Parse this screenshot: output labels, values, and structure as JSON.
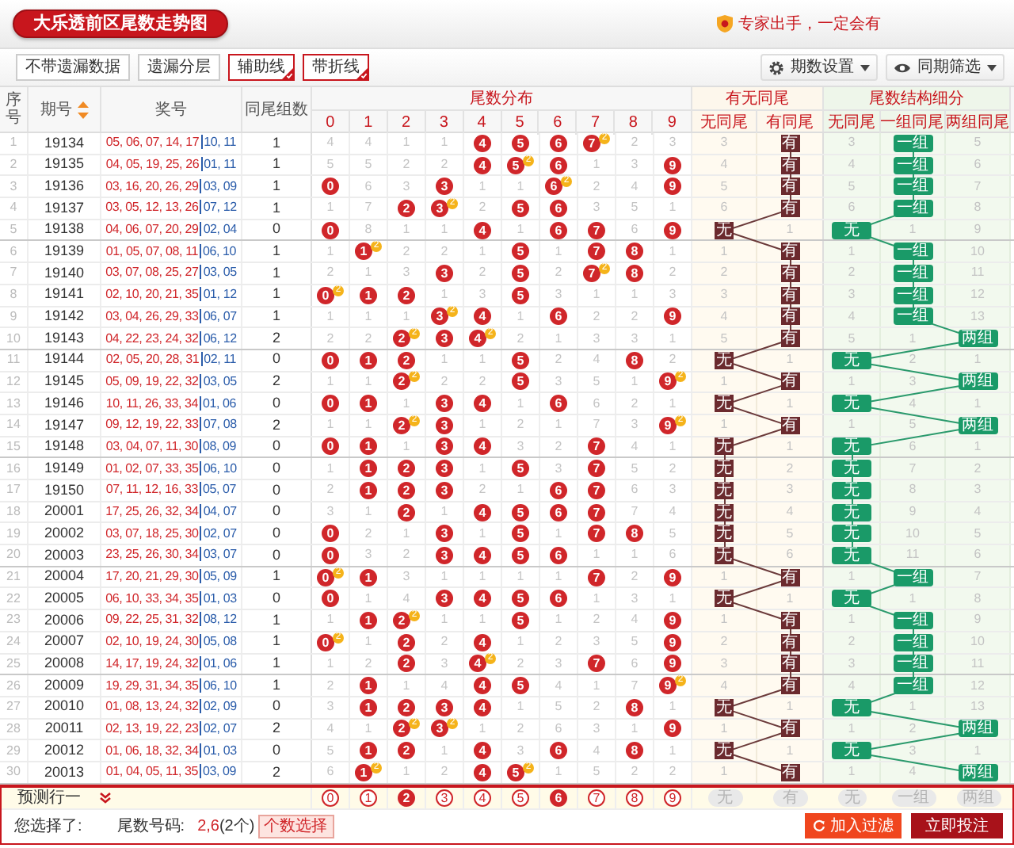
{
  "title": "大乐透前区尾数走势图",
  "promo": "专家出手，一定会有",
  "toolbar": {
    "toggles": [
      {
        "label": "不带遗漏数据",
        "selected": false
      },
      {
        "label": "遗漏分层",
        "selected": false
      },
      {
        "label": "辅助线",
        "selected": true
      },
      {
        "label": "带折线",
        "selected": true
      }
    ],
    "dropdowns": [
      {
        "kind": "settings",
        "label": "期数设置"
      },
      {
        "kind": "view",
        "label": "同期筛选"
      }
    ]
  },
  "columns": {
    "seq": "序号",
    "issue": "期号",
    "numbers": "奖号",
    "count": "同尾组数",
    "tail_group": "尾数分布",
    "tail_digits": [
      "0",
      "1",
      "2",
      "3",
      "4",
      "5",
      "6",
      "7",
      "8",
      "9"
    ],
    "same_group": "有无同尾",
    "same_cols": [
      "无同尾",
      "有同尾"
    ],
    "structure_group": "尾数结构细分",
    "structure_cols": [
      "无同尾",
      "一组同尾",
      "两组同尾"
    ]
  },
  "rows": [
    {
      "seq": "1",
      "issue": "19134",
      "front": "05, 06, 07, 14, 17",
      "back": "10, 11",
      "count": "1",
      "tails": [
        {
          "text": "4",
          "hit": false
        },
        {
          "text": "4",
          "hit": false
        },
        {
          "text": "1",
          "hit": false
        },
        {
          "text": "1",
          "hit": false
        },
        {
          "text": "4",
          "hit": true
        },
        {
          "text": "5",
          "hit": true
        },
        {
          "text": "6",
          "hit": true
        },
        {
          "text": "7",
          "hit": true,
          "badge": "2"
        },
        {
          "text": "2",
          "hit": false
        },
        {
          "text": "3",
          "hit": false
        }
      ],
      "same_tail": [
        {
          "text": "3",
          "hit": false
        },
        {
          "text": "有",
          "hit": true
        }
      ],
      "structure": [
        {
          "text": "3",
          "hit": false
        },
        {
          "text": "一组",
          "hit": true
        },
        {
          "text": "5",
          "hit": false
        }
      ]
    },
    {
      "seq": "2",
      "issue": "19135",
      "front": "04, 05, 19, 25, 26",
      "back": "01, 11",
      "count": "1",
      "tails": [
        {
          "text": "5",
          "hit": false
        },
        {
          "text": "5",
          "hit": false
        },
        {
          "text": "2",
          "hit": false
        },
        {
          "text": "2",
          "hit": false
        },
        {
          "text": "4",
          "hit": true
        },
        {
          "text": "5",
          "hit": true,
          "badge": "2"
        },
        {
          "text": "6",
          "hit": true
        },
        {
          "text": "1",
          "hit": false
        },
        {
          "text": "3",
          "hit": false
        },
        {
          "text": "9",
          "hit": true
        }
      ],
      "same_tail": [
        {
          "text": "4",
          "hit": false
        },
        {
          "text": "有",
          "hit": true
        }
      ],
      "structure": [
        {
          "text": "4",
          "hit": false
        },
        {
          "text": "一组",
          "hit": true
        },
        {
          "text": "6",
          "hit": false
        }
      ]
    },
    {
      "seq": "3",
      "issue": "19136",
      "front": "03, 16, 20, 26, 29",
      "back": "03, 09",
      "count": "1",
      "tails": [
        {
          "text": "0",
          "hit": true
        },
        {
          "text": "6",
          "hit": false
        },
        {
          "text": "3",
          "hit": false
        },
        {
          "text": "3",
          "hit": true
        },
        {
          "text": "1",
          "hit": false
        },
        {
          "text": "1",
          "hit": false
        },
        {
          "text": "6",
          "hit": true,
          "badge": "2"
        },
        {
          "text": "2",
          "hit": false
        },
        {
          "text": "4",
          "hit": false
        },
        {
          "text": "9",
          "hit": true
        }
      ],
      "same_tail": [
        {
          "text": "5",
          "hit": false
        },
        {
          "text": "有",
          "hit": true
        }
      ],
      "structure": [
        {
          "text": "5",
          "hit": false
        },
        {
          "text": "一组",
          "hit": true
        },
        {
          "text": "7",
          "hit": false
        }
      ]
    },
    {
      "seq": "4",
      "issue": "19137",
      "front": "03, 05, 12, 13, 26",
      "back": "07, 12",
      "count": "1",
      "tails": [
        {
          "text": "1",
          "hit": false
        },
        {
          "text": "7",
          "hit": false
        },
        {
          "text": "2",
          "hit": true
        },
        {
          "text": "3",
          "hit": true,
          "badge": "2"
        },
        {
          "text": "2",
          "hit": false
        },
        {
          "text": "5",
          "hit": true
        },
        {
          "text": "6",
          "hit": true
        },
        {
          "text": "3",
          "hit": false
        },
        {
          "text": "5",
          "hit": false
        },
        {
          "text": "1",
          "hit": false
        }
      ],
      "same_tail": [
        {
          "text": "6",
          "hit": false
        },
        {
          "text": "有",
          "hit": true
        }
      ],
      "structure": [
        {
          "text": "6",
          "hit": false
        },
        {
          "text": "一组",
          "hit": true
        },
        {
          "text": "8",
          "hit": false
        }
      ]
    },
    {
      "seq": "5",
      "issue": "19138",
      "front": "04, 06, 07, 20, 29",
      "back": "02, 04",
      "count": "0",
      "tails": [
        {
          "text": "0",
          "hit": true
        },
        {
          "text": "8",
          "hit": false
        },
        {
          "text": "1",
          "hit": false
        },
        {
          "text": "1",
          "hit": false
        },
        {
          "text": "4",
          "hit": true
        },
        {
          "text": "1",
          "hit": false
        },
        {
          "text": "6",
          "hit": true
        },
        {
          "text": "7",
          "hit": true
        },
        {
          "text": "6",
          "hit": false
        },
        {
          "text": "9",
          "hit": true
        }
      ],
      "same_tail": [
        {
          "text": "无",
          "hit": true
        },
        {
          "text": "1",
          "hit": false
        }
      ],
      "structure": [
        {
          "text": "无",
          "hit": true
        },
        {
          "text": "1",
          "hit": false
        },
        {
          "text": "9",
          "hit": false
        }
      ]
    },
    {
      "seq": "6",
      "issue": "19139",
      "front": "01, 05, 07, 08, 11",
      "back": "06, 10",
      "count": "1",
      "tails": [
        {
          "text": "1",
          "hit": false
        },
        {
          "text": "1",
          "hit": true,
          "badge": "2"
        },
        {
          "text": "2",
          "hit": false
        },
        {
          "text": "2",
          "hit": false
        },
        {
          "text": "1",
          "hit": false
        },
        {
          "text": "5",
          "hit": true
        },
        {
          "text": "1",
          "hit": false
        },
        {
          "text": "7",
          "hit": true
        },
        {
          "text": "8",
          "hit": true
        },
        {
          "text": "1",
          "hit": false
        }
      ],
      "same_tail": [
        {
          "text": "1",
          "hit": false
        },
        {
          "text": "有",
          "hit": true
        }
      ],
      "structure": [
        {
          "text": "1",
          "hit": false
        },
        {
          "text": "一组",
          "hit": true
        },
        {
          "text": "10",
          "hit": false
        }
      ]
    },
    {
      "seq": "7",
      "issue": "19140",
      "front": "03, 07, 08, 25, 27",
      "back": "03, 05",
      "count": "1",
      "tails": [
        {
          "text": "2",
          "hit": false
        },
        {
          "text": "1",
          "hit": false
        },
        {
          "text": "3",
          "hit": false
        },
        {
          "text": "3",
          "hit": true
        },
        {
          "text": "2",
          "hit": false
        },
        {
          "text": "5",
          "hit": true
        },
        {
          "text": "2",
          "hit": false
        },
        {
          "text": "7",
          "hit": true,
          "badge": "2"
        },
        {
          "text": "8",
          "hit": true
        },
        {
          "text": "2",
          "hit": false
        }
      ],
      "same_tail": [
        {
          "text": "2",
          "hit": false
        },
        {
          "text": "有",
          "hit": true
        }
      ],
      "structure": [
        {
          "text": "2",
          "hit": false
        },
        {
          "text": "一组",
          "hit": true
        },
        {
          "text": "11",
          "hit": false
        }
      ]
    },
    {
      "seq": "8",
      "issue": "19141",
      "front": "02, 10, 20, 21, 35",
      "back": "01, 12",
      "count": "1",
      "tails": [
        {
          "text": "0",
          "hit": true,
          "badge": "2"
        },
        {
          "text": "1",
          "hit": true
        },
        {
          "text": "2",
          "hit": true
        },
        {
          "text": "1",
          "hit": false
        },
        {
          "text": "3",
          "hit": false
        },
        {
          "text": "5",
          "hit": true
        },
        {
          "text": "3",
          "hit": false
        },
        {
          "text": "1",
          "hit": false
        },
        {
          "text": "1",
          "hit": false
        },
        {
          "text": "3",
          "hit": false
        }
      ],
      "same_tail": [
        {
          "text": "3",
          "hit": false
        },
        {
          "text": "有",
          "hit": true
        }
      ],
      "structure": [
        {
          "text": "3",
          "hit": false
        },
        {
          "text": "一组",
          "hit": true
        },
        {
          "text": "12",
          "hit": false
        }
      ]
    },
    {
      "seq": "9",
      "issue": "19142",
      "front": "03, 04, 26, 29, 33",
      "back": "06, 07",
      "count": "1",
      "tails": [
        {
          "text": "1",
          "hit": false
        },
        {
          "text": "1",
          "hit": false
        },
        {
          "text": "1",
          "hit": false
        },
        {
          "text": "3",
          "hit": true,
          "badge": "2"
        },
        {
          "text": "4",
          "hit": true
        },
        {
          "text": "1",
          "hit": false
        },
        {
          "text": "6",
          "hit": true
        },
        {
          "text": "2",
          "hit": false
        },
        {
          "text": "2",
          "hit": false
        },
        {
          "text": "9",
          "hit": true
        }
      ],
      "same_tail": [
        {
          "text": "4",
          "hit": false
        },
        {
          "text": "有",
          "hit": true
        }
      ],
      "structure": [
        {
          "text": "4",
          "hit": false
        },
        {
          "text": "一组",
          "hit": true
        },
        {
          "text": "13",
          "hit": false
        }
      ]
    },
    {
      "seq": "10",
      "issue": "19143",
      "front": "04, 22, 23, 24, 32",
      "back": "06, 12",
      "count": "2",
      "tails": [
        {
          "text": "2",
          "hit": false
        },
        {
          "text": "2",
          "hit": false
        },
        {
          "text": "2",
          "hit": true,
          "badge": "2"
        },
        {
          "text": "3",
          "hit": true
        },
        {
          "text": "4",
          "hit": true,
          "badge": "2"
        },
        {
          "text": "2",
          "hit": false
        },
        {
          "text": "1",
          "hit": false
        },
        {
          "text": "3",
          "hit": false
        },
        {
          "text": "3",
          "hit": false
        },
        {
          "text": "1",
          "hit": false
        }
      ],
      "same_tail": [
        {
          "text": "5",
          "hit": false
        },
        {
          "text": "有",
          "hit": true
        }
      ],
      "structure": [
        {
          "text": "5",
          "hit": false
        },
        {
          "text": "1",
          "hit": false
        },
        {
          "text": "两组",
          "hit": true
        }
      ]
    },
    {
      "seq": "11",
      "issue": "19144",
      "front": "02, 05, 20, 28, 31",
      "back": "02, 11",
      "count": "0",
      "tails": [
        {
          "text": "0",
          "hit": true
        },
        {
          "text": "1",
          "hit": true
        },
        {
          "text": "2",
          "hit": true
        },
        {
          "text": "1",
          "hit": false
        },
        {
          "text": "1",
          "hit": false
        },
        {
          "text": "5",
          "hit": true
        },
        {
          "text": "2",
          "hit": false
        },
        {
          "text": "4",
          "hit": false
        },
        {
          "text": "8",
          "hit": true
        },
        {
          "text": "2",
          "hit": false
        }
      ],
      "same_tail": [
        {
          "text": "无",
          "hit": true
        },
        {
          "text": "1",
          "hit": false
        }
      ],
      "structure": [
        {
          "text": "无",
          "hit": true
        },
        {
          "text": "2",
          "hit": false
        },
        {
          "text": "1",
          "hit": false
        }
      ]
    },
    {
      "seq": "12",
      "issue": "19145",
      "front": "05, 09, 19, 22, 32",
      "back": "03, 05",
      "count": "2",
      "tails": [
        {
          "text": "1",
          "hit": false
        },
        {
          "text": "1",
          "hit": false
        },
        {
          "text": "2",
          "hit": true,
          "badge": "2"
        },
        {
          "text": "2",
          "hit": false
        },
        {
          "text": "2",
          "hit": false
        },
        {
          "text": "5",
          "hit": true
        },
        {
          "text": "3",
          "hit": false
        },
        {
          "text": "5",
          "hit": false
        },
        {
          "text": "1",
          "hit": false
        },
        {
          "text": "9",
          "hit": true,
          "badge": "2"
        }
      ],
      "same_tail": [
        {
          "text": "1",
          "hit": false
        },
        {
          "text": "有",
          "hit": true
        }
      ],
      "structure": [
        {
          "text": "1",
          "hit": false
        },
        {
          "text": "3",
          "hit": false
        },
        {
          "text": "两组",
          "hit": true
        }
      ]
    },
    {
      "seq": "13",
      "issue": "19146",
      "front": "10, 11, 26, 33, 34",
      "back": "01, 06",
      "count": "0",
      "tails": [
        {
          "text": "0",
          "hit": true
        },
        {
          "text": "1",
          "hit": true
        },
        {
          "text": "1",
          "hit": false
        },
        {
          "text": "3",
          "hit": true
        },
        {
          "text": "4",
          "hit": true
        },
        {
          "text": "1",
          "hit": false
        },
        {
          "text": "6",
          "hit": true
        },
        {
          "text": "6",
          "hit": false
        },
        {
          "text": "2",
          "hit": false
        },
        {
          "text": "1",
          "hit": false
        }
      ],
      "same_tail": [
        {
          "text": "无",
          "hit": true
        },
        {
          "text": "1",
          "hit": false
        }
      ],
      "structure": [
        {
          "text": "无",
          "hit": true
        },
        {
          "text": "4",
          "hit": false
        },
        {
          "text": "1",
          "hit": false
        }
      ]
    },
    {
      "seq": "14",
      "issue": "19147",
      "front": "09, 12, 19, 22, 33",
      "back": "07, 08",
      "count": "2",
      "tails": [
        {
          "text": "1",
          "hit": false
        },
        {
          "text": "1",
          "hit": false
        },
        {
          "text": "2",
          "hit": true,
          "badge": "2"
        },
        {
          "text": "3",
          "hit": true
        },
        {
          "text": "1",
          "hit": false
        },
        {
          "text": "2",
          "hit": false
        },
        {
          "text": "1",
          "hit": false
        },
        {
          "text": "7",
          "hit": false
        },
        {
          "text": "3",
          "hit": false
        },
        {
          "text": "9",
          "hit": true,
          "badge": "2"
        }
      ],
      "same_tail": [
        {
          "text": "1",
          "hit": false
        },
        {
          "text": "有",
          "hit": true
        }
      ],
      "structure": [
        {
          "text": "1",
          "hit": false
        },
        {
          "text": "5",
          "hit": false
        },
        {
          "text": "两组",
          "hit": true
        }
      ]
    },
    {
      "seq": "15",
      "issue": "19148",
      "front": "03, 04, 07, 11, 30",
      "back": "08, 09",
      "count": "0",
      "tails": [
        {
          "text": "0",
          "hit": true
        },
        {
          "text": "1",
          "hit": true
        },
        {
          "text": "1",
          "hit": false
        },
        {
          "text": "3",
          "hit": true
        },
        {
          "text": "4",
          "hit": true
        },
        {
          "text": "3",
          "hit": false
        },
        {
          "text": "2",
          "hit": false
        },
        {
          "text": "7",
          "hit": true
        },
        {
          "text": "4",
          "hit": false
        },
        {
          "text": "1",
          "hit": false
        }
      ],
      "same_tail": [
        {
          "text": "无",
          "hit": true
        },
        {
          "text": "1",
          "hit": false
        }
      ],
      "structure": [
        {
          "text": "无",
          "hit": true
        },
        {
          "text": "6",
          "hit": false
        },
        {
          "text": "1",
          "hit": false
        }
      ]
    },
    {
      "seq": "16",
      "issue": "19149",
      "front": "01, 02, 07, 33, 35",
      "back": "06, 10",
      "count": "0",
      "tails": [
        {
          "text": "1",
          "hit": false
        },
        {
          "text": "1",
          "hit": true
        },
        {
          "text": "2",
          "hit": true
        },
        {
          "text": "3",
          "hit": true
        },
        {
          "text": "1",
          "hit": false
        },
        {
          "text": "5",
          "hit": true
        },
        {
          "text": "3",
          "hit": false
        },
        {
          "text": "7",
          "hit": true
        },
        {
          "text": "5",
          "hit": false
        },
        {
          "text": "2",
          "hit": false
        }
      ],
      "same_tail": [
        {
          "text": "无",
          "hit": true
        },
        {
          "text": "2",
          "hit": false
        }
      ],
      "structure": [
        {
          "text": "无",
          "hit": true
        },
        {
          "text": "7",
          "hit": false
        },
        {
          "text": "2",
          "hit": false
        }
      ]
    },
    {
      "seq": "17",
      "issue": "19150",
      "front": "07, 11, 12, 16, 33",
      "back": "05, 07",
      "count": "0",
      "tails": [
        {
          "text": "2",
          "hit": false
        },
        {
          "text": "1",
          "hit": true
        },
        {
          "text": "2",
          "hit": true
        },
        {
          "text": "3",
          "hit": true
        },
        {
          "text": "2",
          "hit": false
        },
        {
          "text": "1",
          "hit": false
        },
        {
          "text": "6",
          "hit": true
        },
        {
          "text": "7",
          "hit": true
        },
        {
          "text": "6",
          "hit": false
        },
        {
          "text": "3",
          "hit": false
        }
      ],
      "same_tail": [
        {
          "text": "无",
          "hit": true
        },
        {
          "text": "3",
          "hit": false
        }
      ],
      "structure": [
        {
          "text": "无",
          "hit": true
        },
        {
          "text": "8",
          "hit": false
        },
        {
          "text": "3",
          "hit": false
        }
      ]
    },
    {
      "seq": "18",
      "issue": "20001",
      "front": "17, 25, 26, 32, 34",
      "back": "04, 07",
      "count": "0",
      "tails": [
        {
          "text": "3",
          "hit": false
        },
        {
          "text": "1",
          "hit": false
        },
        {
          "text": "2",
          "hit": true
        },
        {
          "text": "1",
          "hit": false
        },
        {
          "text": "4",
          "hit": true
        },
        {
          "text": "5",
          "hit": true
        },
        {
          "text": "6",
          "hit": true
        },
        {
          "text": "7",
          "hit": true
        },
        {
          "text": "7",
          "hit": false
        },
        {
          "text": "4",
          "hit": false
        }
      ],
      "same_tail": [
        {
          "text": "无",
          "hit": true
        },
        {
          "text": "4",
          "hit": false
        }
      ],
      "structure": [
        {
          "text": "无",
          "hit": true
        },
        {
          "text": "9",
          "hit": false
        },
        {
          "text": "4",
          "hit": false
        }
      ]
    },
    {
      "seq": "19",
      "issue": "20002",
      "front": "03, 07, 18, 25, 30",
      "back": "02, 07",
      "count": "0",
      "tails": [
        {
          "text": "0",
          "hit": true
        },
        {
          "text": "2",
          "hit": false
        },
        {
          "text": "1",
          "hit": false
        },
        {
          "text": "3",
          "hit": true
        },
        {
          "text": "1",
          "hit": false
        },
        {
          "text": "5",
          "hit": true
        },
        {
          "text": "1",
          "hit": false
        },
        {
          "text": "7",
          "hit": true
        },
        {
          "text": "8",
          "hit": true
        },
        {
          "text": "5",
          "hit": false
        }
      ],
      "same_tail": [
        {
          "text": "无",
          "hit": true
        },
        {
          "text": "5",
          "hit": false
        }
      ],
      "structure": [
        {
          "text": "无",
          "hit": true
        },
        {
          "text": "10",
          "hit": false
        },
        {
          "text": "5",
          "hit": false
        }
      ]
    },
    {
      "seq": "20",
      "issue": "20003",
      "front": "23, 25, 26, 30, 34",
      "back": "03, 07",
      "count": "0",
      "tails": [
        {
          "text": "0",
          "hit": true
        },
        {
          "text": "3",
          "hit": false
        },
        {
          "text": "2",
          "hit": false
        },
        {
          "text": "3",
          "hit": true
        },
        {
          "text": "4",
          "hit": true
        },
        {
          "text": "5",
          "hit": true
        },
        {
          "text": "6",
          "hit": true
        },
        {
          "text": "1",
          "hit": false
        },
        {
          "text": "1",
          "hit": false
        },
        {
          "text": "6",
          "hit": false
        }
      ],
      "same_tail": [
        {
          "text": "无",
          "hit": true
        },
        {
          "text": "6",
          "hit": false
        }
      ],
      "structure": [
        {
          "text": "无",
          "hit": true
        },
        {
          "text": "11",
          "hit": false
        },
        {
          "text": "6",
          "hit": false
        }
      ]
    },
    {
      "seq": "21",
      "issue": "20004",
      "front": "17, 20, 21, 29, 30",
      "back": "05, 09",
      "count": "1",
      "tails": [
        {
          "text": "0",
          "hit": true,
          "badge": "2"
        },
        {
          "text": "1",
          "hit": true
        },
        {
          "text": "3",
          "hit": false
        },
        {
          "text": "1",
          "hit": false
        },
        {
          "text": "1",
          "hit": false
        },
        {
          "text": "1",
          "hit": false
        },
        {
          "text": "1",
          "hit": false
        },
        {
          "text": "7",
          "hit": true
        },
        {
          "text": "2",
          "hit": false
        },
        {
          "text": "9",
          "hit": true
        }
      ],
      "same_tail": [
        {
          "text": "1",
          "hit": false
        },
        {
          "text": "有",
          "hit": true
        }
      ],
      "structure": [
        {
          "text": "1",
          "hit": false
        },
        {
          "text": "一组",
          "hit": true
        },
        {
          "text": "7",
          "hit": false
        }
      ]
    },
    {
      "seq": "22",
      "issue": "20005",
      "front": "06, 10, 33, 34, 35",
      "back": "01, 03",
      "count": "0",
      "tails": [
        {
          "text": "0",
          "hit": true
        },
        {
          "text": "1",
          "hit": false
        },
        {
          "text": "4",
          "hit": false
        },
        {
          "text": "3",
          "hit": true
        },
        {
          "text": "4",
          "hit": true
        },
        {
          "text": "5",
          "hit": true
        },
        {
          "text": "6",
          "hit": true
        },
        {
          "text": "1",
          "hit": false
        },
        {
          "text": "3",
          "hit": false
        },
        {
          "text": "1",
          "hit": false
        }
      ],
      "same_tail": [
        {
          "text": "无",
          "hit": true
        },
        {
          "text": "1",
          "hit": false
        }
      ],
      "structure": [
        {
          "text": "无",
          "hit": true
        },
        {
          "text": "1",
          "hit": false
        },
        {
          "text": "8",
          "hit": false
        }
      ]
    },
    {
      "seq": "23",
      "issue": "20006",
      "front": "09, 22, 25, 31, 32",
      "back": "08, 12",
      "count": "1",
      "tails": [
        {
          "text": "1",
          "hit": false
        },
        {
          "text": "1",
          "hit": true
        },
        {
          "text": "2",
          "hit": true,
          "badge": "2"
        },
        {
          "text": "1",
          "hit": false
        },
        {
          "text": "1",
          "hit": false
        },
        {
          "text": "5",
          "hit": true
        },
        {
          "text": "1",
          "hit": false
        },
        {
          "text": "2",
          "hit": false
        },
        {
          "text": "4",
          "hit": false
        },
        {
          "text": "9",
          "hit": true
        }
      ],
      "same_tail": [
        {
          "text": "1",
          "hit": false
        },
        {
          "text": "有",
          "hit": true
        }
      ],
      "structure": [
        {
          "text": "1",
          "hit": false
        },
        {
          "text": "一组",
          "hit": true
        },
        {
          "text": "9",
          "hit": false
        }
      ]
    },
    {
      "seq": "24",
      "issue": "20007",
      "front": "02, 10, 19, 24, 30",
      "back": "05, 08",
      "count": "1",
      "tails": [
        {
          "text": "0",
          "hit": true,
          "badge": "2"
        },
        {
          "text": "1",
          "hit": false
        },
        {
          "text": "2",
          "hit": true
        },
        {
          "text": "2",
          "hit": false
        },
        {
          "text": "4",
          "hit": true
        },
        {
          "text": "1",
          "hit": false
        },
        {
          "text": "2",
          "hit": false
        },
        {
          "text": "3",
          "hit": false
        },
        {
          "text": "5",
          "hit": false
        },
        {
          "text": "9",
          "hit": true
        }
      ],
      "same_tail": [
        {
          "text": "2",
          "hit": false
        },
        {
          "text": "有",
          "hit": true
        }
      ],
      "structure": [
        {
          "text": "2",
          "hit": false
        },
        {
          "text": "一组",
          "hit": true
        },
        {
          "text": "10",
          "hit": false
        }
      ]
    },
    {
      "seq": "25",
      "issue": "20008",
      "front": "14, 17, 19, 24, 32",
      "back": "01, 06",
      "count": "1",
      "tails": [
        {
          "text": "1",
          "hit": false
        },
        {
          "text": "2",
          "hit": false
        },
        {
          "text": "2",
          "hit": true
        },
        {
          "text": "3",
          "hit": false
        },
        {
          "text": "4",
          "hit": true,
          "badge": "2"
        },
        {
          "text": "2",
          "hit": false
        },
        {
          "text": "3",
          "hit": false
        },
        {
          "text": "7",
          "hit": true
        },
        {
          "text": "6",
          "hit": false
        },
        {
          "text": "9",
          "hit": true
        }
      ],
      "same_tail": [
        {
          "text": "3",
          "hit": false
        },
        {
          "text": "有",
          "hit": true
        }
      ],
      "structure": [
        {
          "text": "3",
          "hit": false
        },
        {
          "text": "一组",
          "hit": true
        },
        {
          "text": "11",
          "hit": false
        }
      ]
    },
    {
      "seq": "26",
      "issue": "20009",
      "front": "19, 29, 31, 34, 35",
      "back": "06, 10",
      "count": "1",
      "tails": [
        {
          "text": "2",
          "hit": false
        },
        {
          "text": "1",
          "hit": true
        },
        {
          "text": "1",
          "hit": false
        },
        {
          "text": "4",
          "hit": false
        },
        {
          "text": "4",
          "hit": true
        },
        {
          "text": "5",
          "hit": true
        },
        {
          "text": "4",
          "hit": false
        },
        {
          "text": "1",
          "hit": false
        },
        {
          "text": "7",
          "hit": false
        },
        {
          "text": "9",
          "hit": true,
          "badge": "2"
        }
      ],
      "same_tail": [
        {
          "text": "4",
          "hit": false
        },
        {
          "text": "有",
          "hit": true
        }
      ],
      "structure": [
        {
          "text": "4",
          "hit": false
        },
        {
          "text": "一组",
          "hit": true
        },
        {
          "text": "12",
          "hit": false
        }
      ]
    },
    {
      "seq": "27",
      "issue": "20010",
      "front": "01, 08, 13, 24, 32",
      "back": "02, 09",
      "count": "0",
      "tails": [
        {
          "text": "3",
          "hit": false
        },
        {
          "text": "1",
          "hit": true
        },
        {
          "text": "2",
          "hit": true
        },
        {
          "text": "3",
          "hit": true
        },
        {
          "text": "4",
          "hit": true
        },
        {
          "text": "1",
          "hit": false
        },
        {
          "text": "5",
          "hit": false
        },
        {
          "text": "2",
          "hit": false
        },
        {
          "text": "8",
          "hit": true
        },
        {
          "text": "1",
          "hit": false
        }
      ],
      "same_tail": [
        {
          "text": "无",
          "hit": true
        },
        {
          "text": "1",
          "hit": false
        }
      ],
      "structure": [
        {
          "text": "无",
          "hit": true
        },
        {
          "text": "1",
          "hit": false
        },
        {
          "text": "13",
          "hit": false
        }
      ]
    },
    {
      "seq": "28",
      "issue": "20011",
      "front": "02, 13, 19, 22, 23",
      "back": "02, 07",
      "count": "2",
      "tails": [
        {
          "text": "4",
          "hit": false
        },
        {
          "text": "1",
          "hit": false
        },
        {
          "text": "2",
          "hit": true,
          "badge": "2"
        },
        {
          "text": "3",
          "hit": true,
          "badge": "2"
        },
        {
          "text": "1",
          "hit": false
        },
        {
          "text": "2",
          "hit": false
        },
        {
          "text": "6",
          "hit": false
        },
        {
          "text": "3",
          "hit": false
        },
        {
          "text": "1",
          "hit": false
        },
        {
          "text": "9",
          "hit": true
        }
      ],
      "same_tail": [
        {
          "text": "1",
          "hit": false
        },
        {
          "text": "有",
          "hit": true
        }
      ],
      "structure": [
        {
          "text": "1",
          "hit": false
        },
        {
          "text": "2",
          "hit": false
        },
        {
          "text": "两组",
          "hit": true
        }
      ]
    },
    {
      "seq": "29",
      "issue": "20012",
      "front": "01, 06, 18, 32, 34",
      "back": "01, 03",
      "count": "0",
      "tails": [
        {
          "text": "5",
          "hit": false
        },
        {
          "text": "1",
          "hit": true
        },
        {
          "text": "2",
          "hit": true
        },
        {
          "text": "1",
          "hit": false
        },
        {
          "text": "4",
          "hit": true
        },
        {
          "text": "3",
          "hit": false
        },
        {
          "text": "6",
          "hit": true
        },
        {
          "text": "4",
          "hit": false
        },
        {
          "text": "8",
          "hit": true
        },
        {
          "text": "1",
          "hit": false
        }
      ],
      "same_tail": [
        {
          "text": "无",
          "hit": true
        },
        {
          "text": "1",
          "hit": false
        }
      ],
      "structure": [
        {
          "text": "无",
          "hit": true
        },
        {
          "text": "3",
          "hit": false
        },
        {
          "text": "1",
          "hit": false
        }
      ]
    },
    {
      "seq": "30",
      "issue": "20013",
      "front": "01, 04, 05, 11, 35",
      "back": "03, 09",
      "count": "2",
      "tails": [
        {
          "text": "6",
          "hit": false
        },
        {
          "text": "1",
          "hit": true,
          "badge": "2"
        },
        {
          "text": "1",
          "hit": false
        },
        {
          "text": "2",
          "hit": false
        },
        {
          "text": "4",
          "hit": true
        },
        {
          "text": "5",
          "hit": true,
          "badge": "2"
        },
        {
          "text": "1",
          "hit": false
        },
        {
          "text": "5",
          "hit": false
        },
        {
          "text": "2",
          "hit": false
        },
        {
          "text": "2",
          "hit": false
        }
      ],
      "same_tail": [
        {
          "text": "1",
          "hit": false
        },
        {
          "text": "有",
          "hit": true
        }
      ],
      "structure": [
        {
          "text": "1",
          "hit": false
        },
        {
          "text": "4",
          "hit": false
        },
        {
          "text": "两组",
          "hit": true
        }
      ]
    }
  ],
  "prediction": {
    "label": "预测行一",
    "tails": [
      {
        "text": "0",
        "selected": false
      },
      {
        "text": "1",
        "selected": false
      },
      {
        "text": "2",
        "selected": true
      },
      {
        "text": "3",
        "selected": false
      },
      {
        "text": "4",
        "selected": false
      },
      {
        "text": "5",
        "selected": false
      },
      {
        "text": "6",
        "selected": true
      },
      {
        "text": "7",
        "selected": false
      },
      {
        "text": "8",
        "selected": false
      },
      {
        "text": "9",
        "selected": false
      }
    ],
    "same_tail": [
      "无",
      "有"
    ],
    "structure": [
      "无",
      "一组",
      "两组"
    ]
  },
  "selection": {
    "label": "您选择了:",
    "field": "尾数号码:",
    "value": "2,6",
    "count": "(2个)",
    "pick_button": "个数选择",
    "filter_button": "加入过滤",
    "bet_button": "立即投注"
  }
}
